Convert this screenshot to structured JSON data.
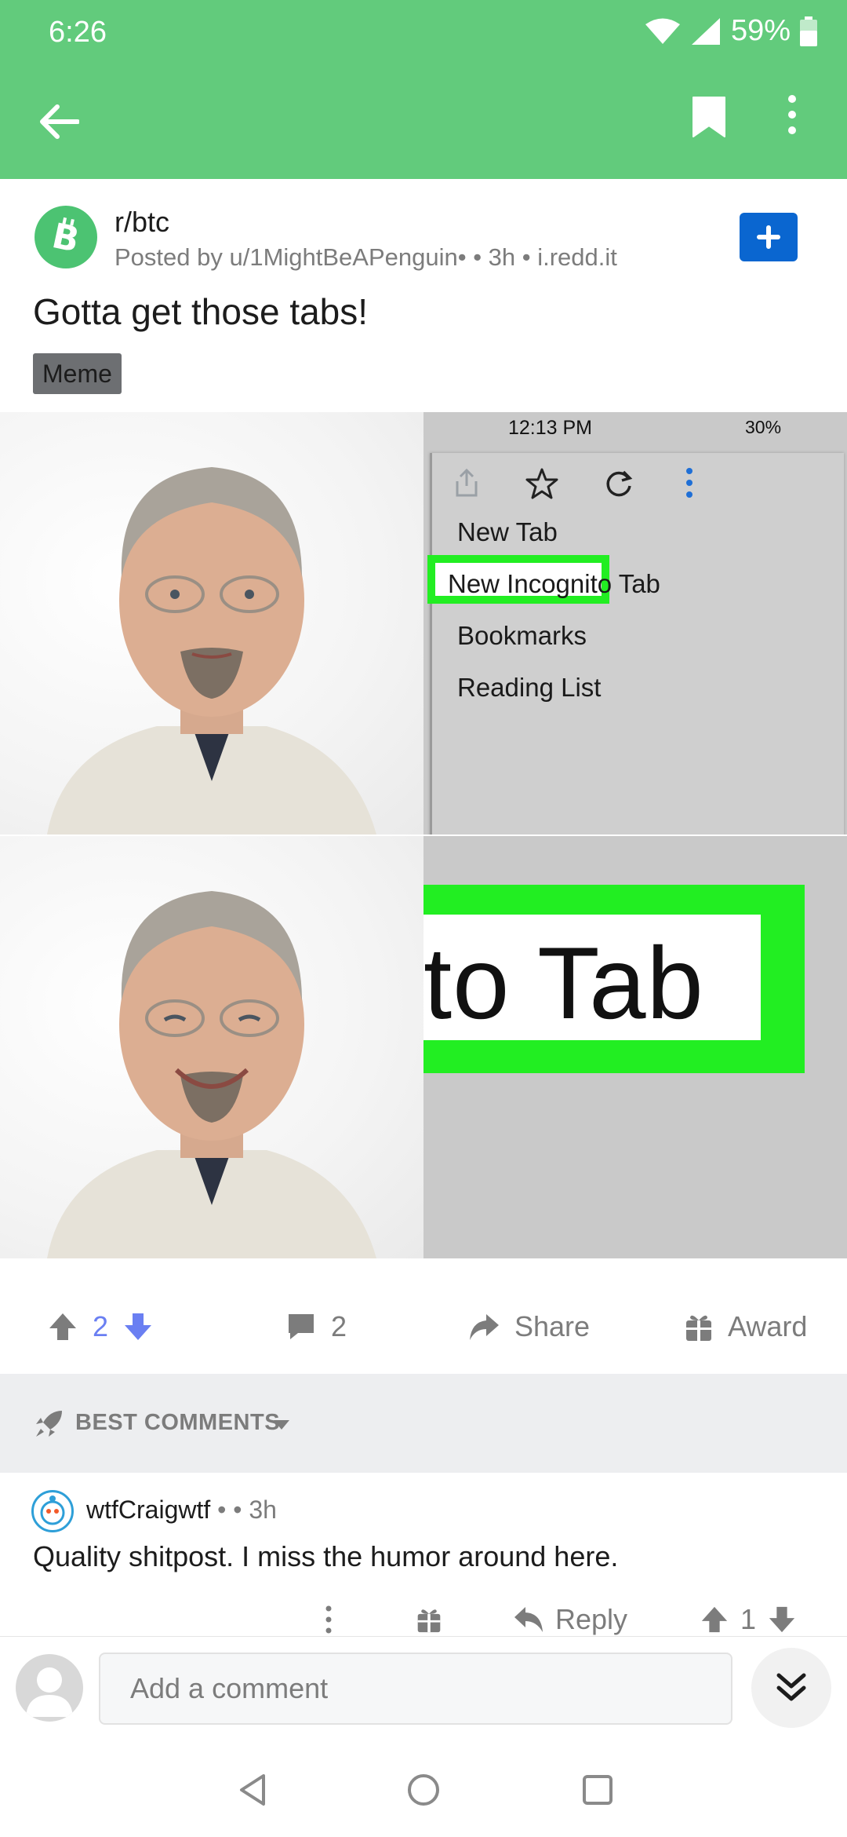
{
  "status": {
    "time": "6:26",
    "battery": "59%"
  },
  "toolbar": {
    "back_icon": "arrow-left-icon",
    "bookmark_icon": "bookmark-icon",
    "more_icon": "more-vertical-icon"
  },
  "post": {
    "subreddit": "r/btc",
    "meta": "Posted by u/1MightBeAPenguin• • 3h • i.redd.it",
    "title": "Gotta get those tabs!",
    "flair": "Meme"
  },
  "meme": {
    "phone_time": "12:13 PM",
    "phone_battery": "30%",
    "menu_items": [
      "New Tab",
      "New Incognito Tab",
      "Bookmarks",
      "Reading List"
    ],
    "zoom_text": "to Tab"
  },
  "actions": {
    "score": "2",
    "comments": "2",
    "share_label": "Share",
    "award_label": "Award"
  },
  "sort": {
    "label": "BEST COMMENTS"
  },
  "comment": {
    "user": "wtfCraigwtf",
    "meta": " • • 3h",
    "body": "Quality shitpost. I miss the humor around here.",
    "reply_label": "Reply",
    "score": "1"
  },
  "composer": {
    "placeholder": "Add a comment"
  },
  "colors": {
    "brand_green": "#62cb7c",
    "upvote_blue": "#6a7ff2",
    "join_blue": "#0a66d0",
    "highlight_green": "#22ee22"
  }
}
